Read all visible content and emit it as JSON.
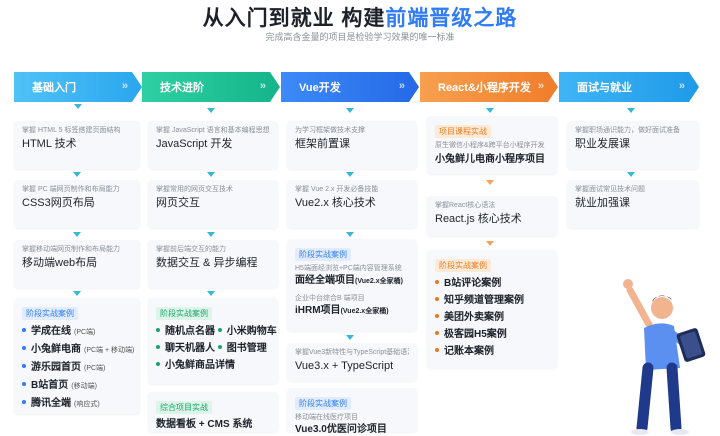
{
  "header": {
    "title_part1": "从入门到就业  构建",
    "title_part2": "前端晋级之路",
    "subtitle": "完成高含金量的项目是检验学习效果的唯一标准"
  },
  "colors": {
    "stage1": "#38b2f0",
    "stage2": "#1cbf95",
    "stage3": "#2f7cf6",
    "stage4": "#f48d3b",
    "stage5": "#2aa9f2",
    "accent": "#2f7cf6"
  },
  "stages": [
    {
      "label": "基础入门",
      "cards": [
        {
          "desc": "掌握 HTML 5 标签搭建页面结构",
          "main": "HTML 技术"
        },
        {
          "desc": "掌握 PC 端网页制作和布局能力",
          "main": "CSS3网页布局"
        },
        {
          "desc": "掌握移动端网页制作和布局能力",
          "main": "移动端web布局"
        }
      ],
      "project_tag": "阶段实战案例",
      "projects": [
        {
          "name": "学成在线",
          "note": "(PC端)"
        },
        {
          "name": "小兔鲜电商",
          "note": "(PC端 + 移动端)"
        },
        {
          "name": "游乐园首页",
          "note": "(PC端)"
        },
        {
          "name": "B站首页",
          "note": "(移动端)"
        },
        {
          "name": "腾讯全端",
          "note": "(响应式)"
        }
      ]
    },
    {
      "label": "技术进阶",
      "cards": [
        {
          "desc": "掌握 JavaScript 语言和基本编程思想",
          "main": "JavaScript 开发"
        },
        {
          "desc": "掌握常用的网页交互技术",
          "main": "网页交互"
        },
        {
          "desc": "掌握前后端交互的能力",
          "main": "数据交互 & 异步编程"
        }
      ],
      "project_tag": "阶段实战案例",
      "projects": [
        {
          "name": "随机点名器"
        },
        {
          "name": "小米购物车"
        },
        {
          "name": "聊天机器人"
        },
        {
          "name": "图书管理"
        },
        {
          "name": "小兔鲜商品详情"
        }
      ],
      "final_tag": "综合项目实战",
      "final_main": "数据看板 + CMS 系统"
    },
    {
      "label": "Vue开发",
      "cards": [
        {
          "desc": "为学习框架做技术支撑",
          "main": "框架前置课"
        },
        {
          "desc": "掌握 Vue 2.x 开发必备技能",
          "main": "Vue2.x 核心技术"
        }
      ],
      "project_tag": "阶段实战案例",
      "projects": [
        {
          "desc": "H5端面经浏览+PC端内容管理系统",
          "name": "面经全端项目",
          "note": "(Vue2.x全家桶)"
        },
        {
          "desc": "企业中台综合B 端项目",
          "name": "iHRM项目",
          "note": "(Vue2.x全家桶)"
        }
      ],
      "card3": {
        "desc": "掌握Vue3新特性与TypeScript基础语法",
        "main": "Vue3.x + TypeScript"
      },
      "project_tag2": "阶段实战案例",
      "project2": {
        "desc": "移动端在线医疗项目",
        "name": "Vue3.0优医问诊项目"
      }
    },
    {
      "label": "React&小程序开发",
      "card1": {
        "tag": "项目课程实战",
        "desc": "原生微信小程序&跨平台小程序开发",
        "main": "小兔鲜儿电商小程序项目"
      },
      "card2": {
        "desc": "掌握React核心语法",
        "main": "React.js 核心技术"
      },
      "project_tag": "阶段实战案例",
      "projects": [
        {
          "name": "B站评论案例"
        },
        {
          "name": "知乎频道管理案例"
        },
        {
          "name": "美团外卖案例"
        },
        {
          "name": "极客园H5案例"
        },
        {
          "name": "记账本案例"
        }
      ]
    },
    {
      "label": "面试与就业",
      "cards": [
        {
          "desc": "掌握职场通识能力，做好面试准备",
          "main": "职业发展课"
        },
        {
          "desc": "掌握面试常见技术问题",
          "main": "就业加强课"
        }
      ]
    }
  ]
}
